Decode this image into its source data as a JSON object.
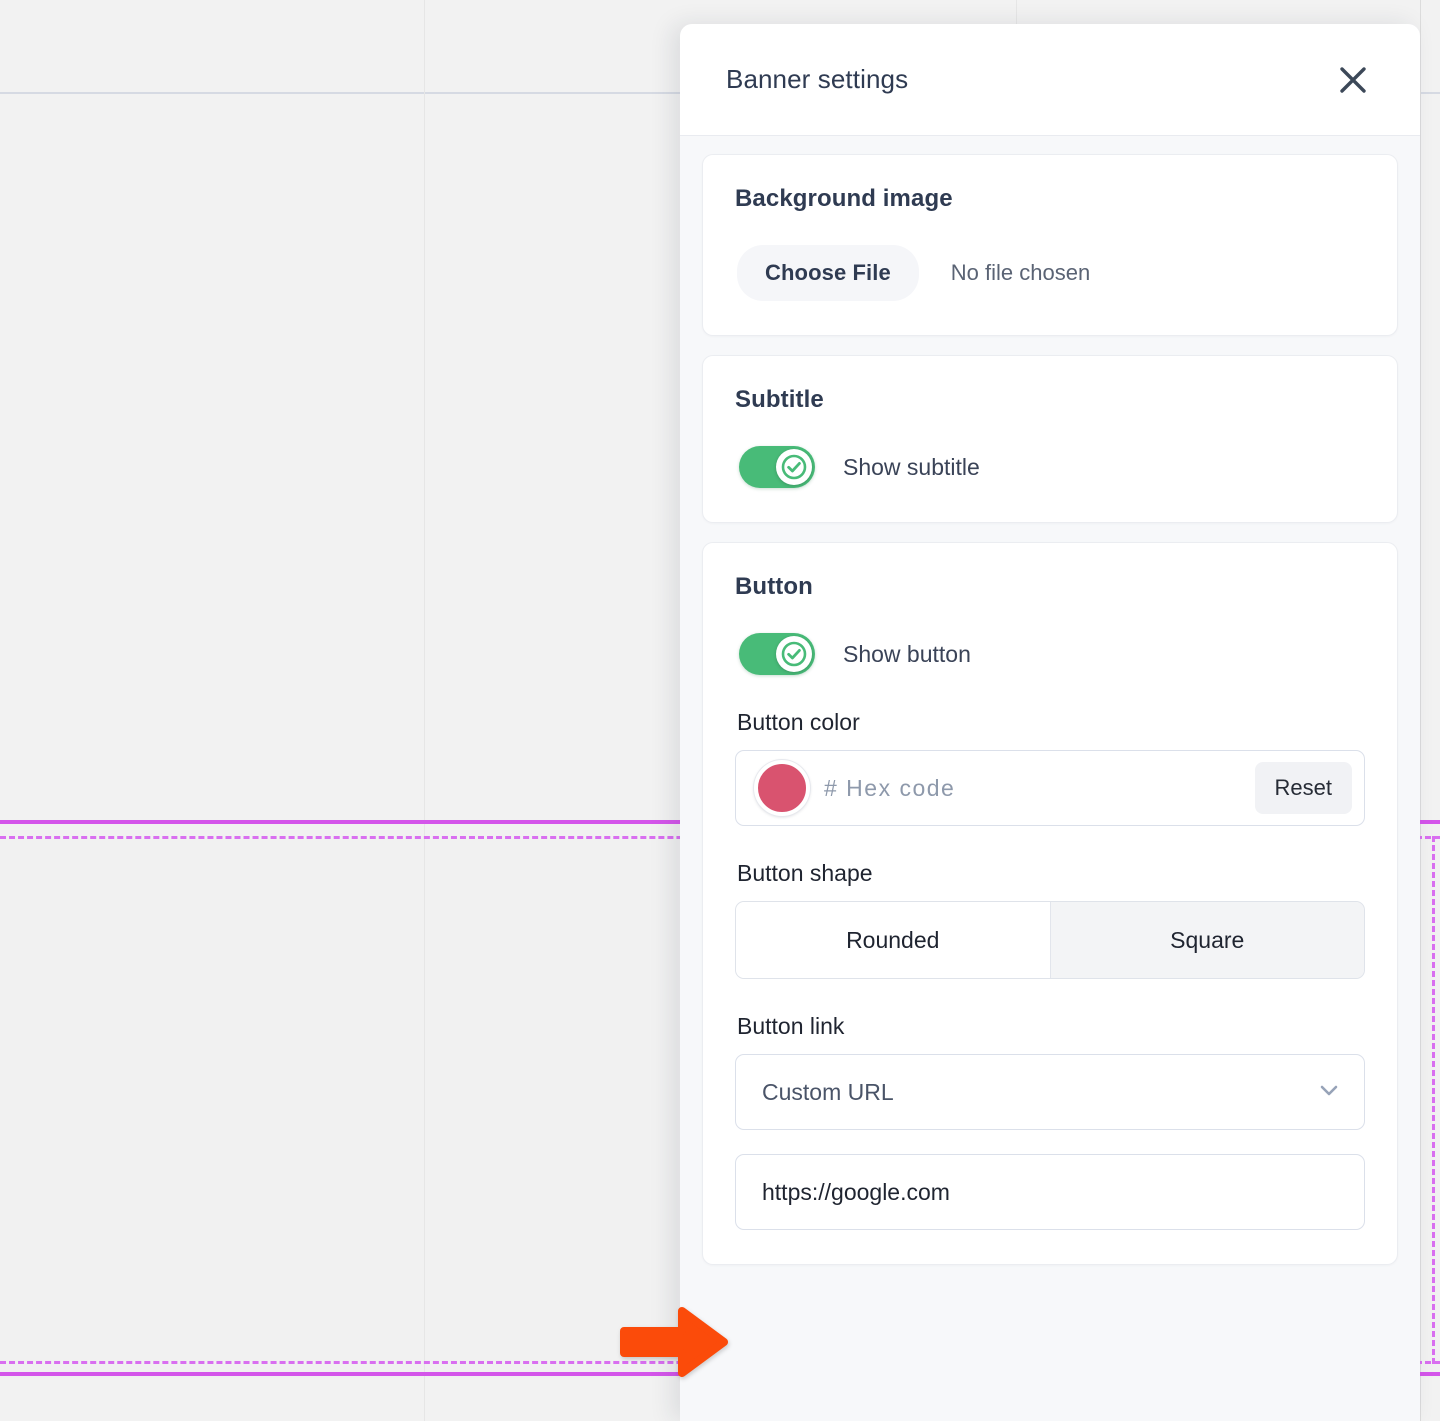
{
  "panel": {
    "title": "Banner settings",
    "close_icon": "close-icon",
    "sections": {
      "background_image": {
        "heading": "Background image",
        "choose_file_label": "Choose File",
        "file_status": "No file chosen"
      },
      "subtitle": {
        "heading": "Subtitle",
        "toggle_label": "Show subtitle",
        "toggle_on": true,
        "toggle_color": "#48bb78"
      },
      "button": {
        "heading": "Button",
        "toggle_label": "Show button",
        "toggle_on": true,
        "color_field": {
          "label": "Button color",
          "swatch_color": "#d9536f",
          "hex_value": "",
          "hex_placeholder": "# Hex code",
          "reset_label": "Reset"
        },
        "shape_field": {
          "label": "Button shape",
          "options": [
            {
              "label": "Rounded",
              "selected": true
            },
            {
              "label": "Square",
              "selected": false
            }
          ]
        },
        "link_field": {
          "label": "Button link",
          "selected_option": "Custom URL",
          "chevron_icon": "chevron-down-icon",
          "url_value": "https://google.com"
        }
      }
    }
  },
  "annotation": {
    "arrow_icon": "arrow-right-icon",
    "arrow_color": "#fb4b0a"
  },
  "background": {
    "guide_color": "#d455ea",
    "divider_color": "#d6dae3"
  }
}
